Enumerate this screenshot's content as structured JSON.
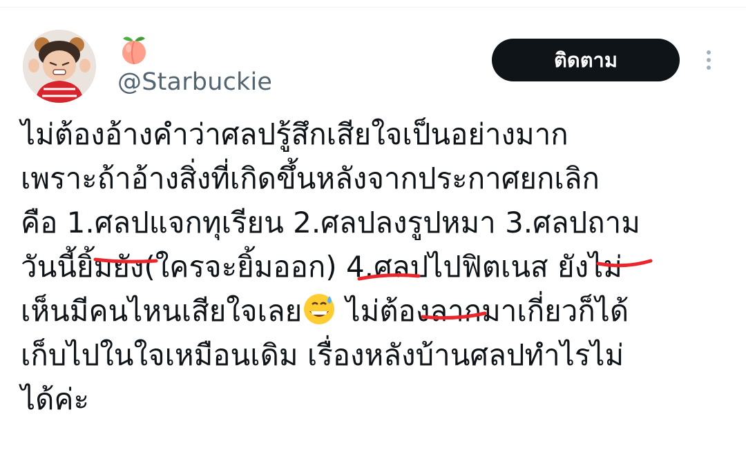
{
  "tweet": {
    "display_name_emoji": "peach-emoji",
    "handle": "@Starbuckie",
    "follow_label": "ติดตาม",
    "lines": [
      "ไม่ต้องอ้างคำว่าศลปรู้สึกเสียใจเป็นอย่างมาก",
      "เพราะถ้าอ้างสิ่งที่เกิดขึ้นหลังจากประกาศยกเลิก",
      "คือ 1.ศลปแจกทุเรียน 2.ศลปลงรูปหมา 3.ศลปถาม",
      "วันนี้ยิ้มยัง(ใครจะยิ้มออก) 4.ศลปไปฟิตเนส ยังไม่",
      "เห็นมีคนไหนเสียใจเลย",
      "ไม่ต้องลากมาเกี่ยวก็ได้",
      "เก็บไปในใจเหมือนเดิม เรื่องหลังบ้านศลปทำไรไม่",
      "ได้ค่ะ"
    ],
    "inline_emoji": "grinning-sweat-emoji",
    "highlight_color": "#e8262b"
  }
}
